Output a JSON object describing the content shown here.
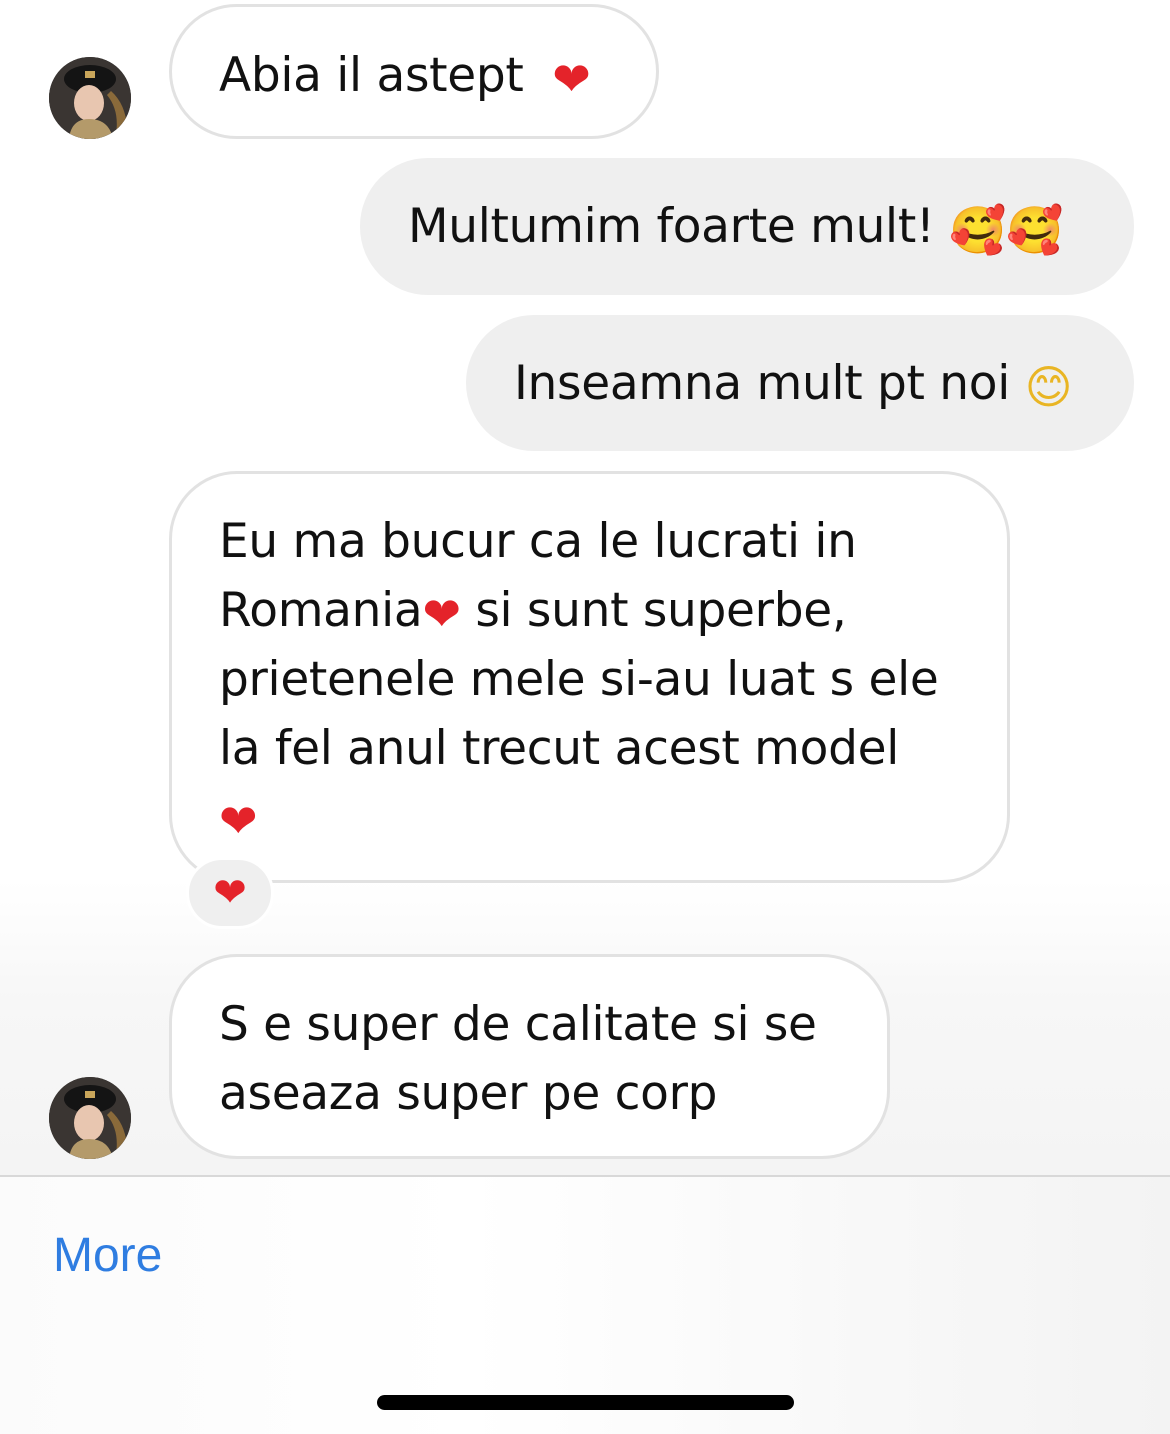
{
  "messages": [
    {
      "sender": "them",
      "text": "Abia il astept",
      "emoji": "❤"
    },
    {
      "sender": "me",
      "text": "Multumim foarte mult!",
      "emoji": "🥰🥰"
    },
    {
      "sender": "me",
      "text": "Inseamna mult pt noi",
      "emoji": "😊"
    },
    {
      "sender": "them",
      "line1": "Eu ma bucur ca le lucrati in",
      "line2a": "Romania",
      "line2emoji": "❤",
      "line2b": " si sunt superbe,",
      "line3": "prietenele mele si-au luat s ele",
      "line4": "la fel anul trecut acest model",
      "line5emoji": "❤",
      "reaction": "❤"
    },
    {
      "sender": "them",
      "line1": "S e super de calitate si se",
      "line2": "aseaza super pe corp"
    }
  ],
  "footer": {
    "more_label": "More"
  },
  "colors": {
    "link": "#2f7de1",
    "heart": "#e4232a",
    "outgoing_bubble": "#efefef",
    "incoming_border": "#e2e2e2"
  },
  "icons": {
    "avatar": "user-avatar",
    "heart": "heart-icon",
    "smile": "smiling-face-icon",
    "hearts_face": "smiling-face-with-hearts-icon"
  }
}
